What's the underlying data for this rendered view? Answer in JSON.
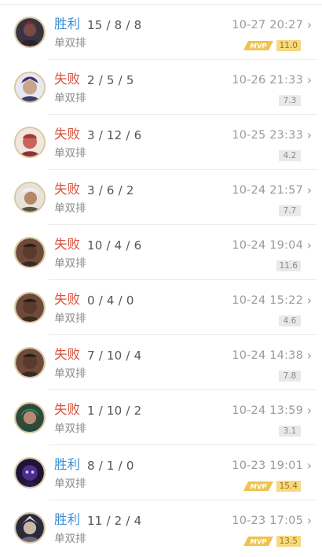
{
  "colors": {
    "win": "#3a8fd6",
    "loss": "#d8523e",
    "mvp": "#f0c34c"
  },
  "matches": [
    {
      "result": "胜利",
      "outcome": "win",
      "kda": "15 / 8 / 8",
      "mode": "单双排",
      "time": "10-27 20:27",
      "score": "11.0",
      "mvp": true,
      "mvp_label": "MVP",
      "hero_icon": "hero-portrait-dark-armored"
    },
    {
      "result": "失败",
      "outcome": "loss",
      "kda": "2 / 5 / 5",
      "mode": "单双排",
      "time": "10-26 21:33",
      "score": "7.3",
      "mvp": false,
      "hero_icon": "hero-portrait-purple-hair"
    },
    {
      "result": "失败",
      "outcome": "loss",
      "kda": "3 / 12 / 6",
      "mode": "单双排",
      "time": "10-25 23:33",
      "score": "4.2",
      "mvp": false,
      "hero_icon": "hero-portrait-red-bald"
    },
    {
      "result": "失败",
      "outcome": "loss",
      "kda": "3 / 6 / 2",
      "mode": "单双排",
      "time": "10-24 21:57",
      "score": "7.7",
      "mvp": false,
      "hero_icon": "hero-portrait-white-hair"
    },
    {
      "result": "失败",
      "outcome": "loss",
      "kda": "10 / 4 / 6",
      "mode": "单双排",
      "time": "10-24 19:04",
      "score": "11.6",
      "mvp": false,
      "hero_icon": "hero-portrait-dark-skin"
    },
    {
      "result": "失败",
      "outcome": "loss",
      "kda": "0 / 4 / 0",
      "mode": "单双排",
      "time": "10-24 15:22",
      "score": "4.6",
      "mvp": false,
      "hero_icon": "hero-portrait-dark-skin"
    },
    {
      "result": "失败",
      "outcome": "loss",
      "kda": "7 / 10 / 4",
      "mode": "单双排",
      "time": "10-24 14:38",
      "score": "7.8",
      "mvp": false,
      "hero_icon": "hero-portrait-dark-skin"
    },
    {
      "result": "失败",
      "outcome": "loss",
      "kda": "1 / 10 / 2",
      "mode": "单双排",
      "time": "10-24 13:59",
      "score": "3.1",
      "mvp": false,
      "hero_icon": "hero-portrait-green-hood"
    },
    {
      "result": "胜利",
      "outcome": "win",
      "kda": "8 / 1 / 0",
      "mode": "单双排",
      "time": "10-23 19:01",
      "score": "15.4",
      "mvp": true,
      "mvp_label": "MVP",
      "hero_icon": "hero-portrait-purple-void"
    },
    {
      "result": "胜利",
      "outcome": "win",
      "kda": "11 / 2 / 4",
      "mode": "单双排",
      "time": "10-23 17:05",
      "score": "13.5",
      "mvp": true,
      "mvp_label": "MVP",
      "hero_icon": "hero-portrait-silver-armor"
    }
  ]
}
